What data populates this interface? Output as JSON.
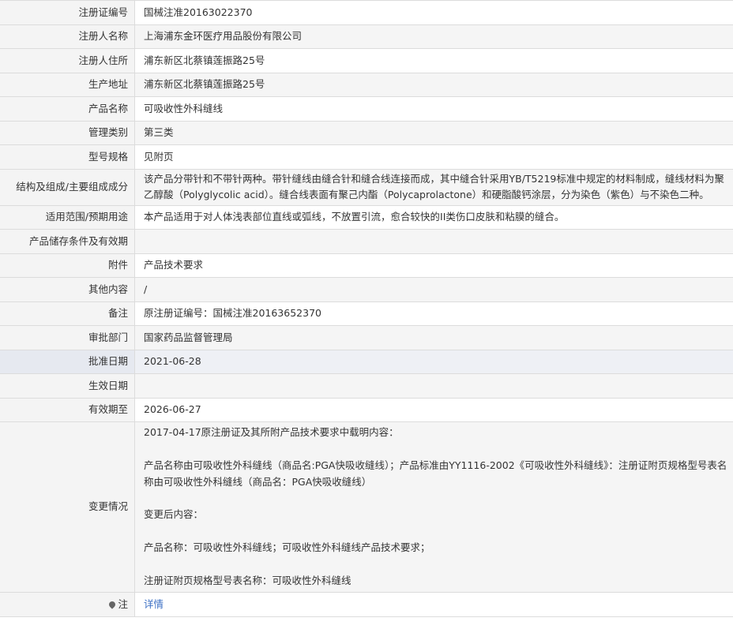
{
  "rows": [
    {
      "label": "注册证编号",
      "value": "国械注准20163022370"
    },
    {
      "label": "注册人名称",
      "value": "上海浦东金环医疗用品股份有限公司"
    },
    {
      "label": "注册人住所",
      "value": "浦东新区北蔡镇莲振路25号"
    },
    {
      "label": "生产地址",
      "value": "浦东新区北蔡镇莲振路25号"
    },
    {
      "label": "产品名称",
      "value": "可吸收性外科缝线"
    },
    {
      "label": "管理类别",
      "value": "第三类"
    },
    {
      "label": "型号规格",
      "value": "见附页"
    },
    {
      "label": "结构及组成/主要组成成分",
      "value": "该产品分带针和不带针两种。带针缝线由缝合针和缝合线连接而成，其中缝合针采用YB/T5219标准中规定的材料制成，缝线材料为聚乙醇酸（Polyglycolic acid）。缝合线表面有聚己内酯（Polycaprolactone）和硬脂酸钙涂层，分为染色（紫色）与不染色二种。"
    },
    {
      "label": "适用范围/预期用途",
      "value": "本产品适用于对人体浅表部位直线或弧线，不放置引流，愈合较快的II类伤口皮肤和粘膜的缝合。"
    },
    {
      "label": "产品储存条件及有效期",
      "value": ""
    },
    {
      "label": "附件",
      "value": "产品技术要求"
    },
    {
      "label": "其他内容",
      "value": "/"
    },
    {
      "label": "备注",
      "value": "原注册证编号：国械注准20163652370"
    },
    {
      "label": "审批部门",
      "value": "国家药品监督管理局"
    },
    {
      "label": "批准日期",
      "value": "2021-06-28"
    },
    {
      "label": "生效日期",
      "value": ""
    },
    {
      "label": "有效期至",
      "value": "2026-06-27"
    }
  ],
  "change": {
    "label": "变更情况",
    "lines": [
      "2017-04-17原注册证及其所附产品技术要求中载明内容：",
      "",
      "产品名称由可吸收性外科缝线（商品名:PGA快吸收缝线）；产品标准由YY1116-2002《可吸收性外科缝线》：注册证附页规格型号表名称由可吸收性外科缝线（商品名：PGA快吸收缝线）",
      "",
      "变更后内容：",
      "",
      "产品名称：可吸收性外科缝线；可吸收性外科缝线产品技术要求；",
      "",
      "注册证附页规格型号表名称：可吸收性外科缝线"
    ]
  },
  "note": {
    "label": "注",
    "icon": "pin-icon",
    "link_text": "详情",
    "link_color": "#3b6fc4"
  }
}
